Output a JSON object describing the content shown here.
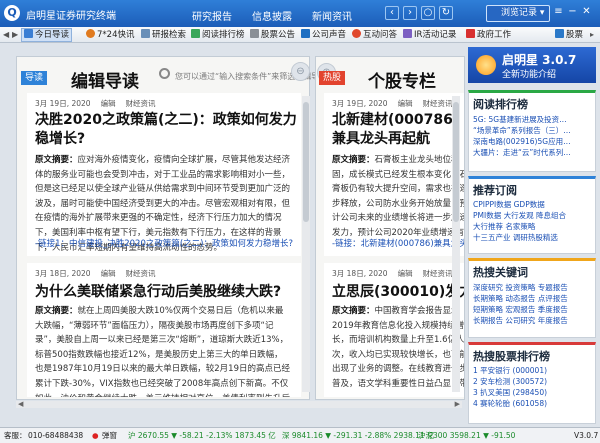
{
  "app": {
    "title": "启明星证券研究终端",
    "logo_glyph": "Q",
    "version": "V3.0.7"
  },
  "topnav": [
    {
      "label": "研究报告"
    },
    {
      "label": "信息披露"
    },
    {
      "label": "新闻资讯"
    }
  ],
  "history_button": "浏览记录",
  "toolbar": {
    "items": [
      {
        "label": "今日导读",
        "icon": "home-icon",
        "active": true
      },
      {
        "label": "7*24快讯",
        "icon": "clock-icon"
      },
      {
        "label": "研报检索",
        "icon": "document-icon"
      },
      {
        "label": "阅读排行榜",
        "icon": "chart-icon"
      },
      {
        "label": "股票公告",
        "icon": "notice-icon"
      },
      {
        "label": "公司声音",
        "icon": "speaker-icon"
      },
      {
        "label": "互动问答",
        "icon": "chat-icon"
      },
      {
        "label": "IR活动记录",
        "icon": "ir-icon"
      },
      {
        "label": "政府工作",
        "icon": "flag-icon"
      },
      {
        "label": "股票",
        "icon": "stock-icon"
      }
    ]
  },
  "left_panel": {
    "badge": "导读",
    "title": "编辑导读",
    "search_placeholder": "您可以通过“输入搜索条件”来筛选编辑导读内容",
    "articles": [
      {
        "date": "3月 19日, 2020",
        "tag1": "编辑",
        "tag2": "财经资讯",
        "title": "决胜2020之政策篇(之二)：政策如何发力稳增长?",
        "abstract_label": "原文摘要：",
        "abstract": "应对海外疫情变化，疫情向全球扩展，尽管其他发达经济体的服务业可能也会受到冲击，对于工业品的需求影响相对小一些，但是这已经足以使全球产业链从供给需求到中间环节受到更加广泛的波及，届时可能使中国经济受到更大的冲击。尽管宏观相对有限，但在疫情的海外扩展带来更强的不确定性，经济下行压力加大的情况下，美国利率中枢有望下行，美元指数有下行压力，在这样的背景下，人民币汇率短期内有望维持高流动性的态势。",
        "link": "-链接1：中信建投_决胜2020之政策篇(之二)：政策如何发力稳增长?"
      },
      {
        "date": "3月 18日, 2020",
        "tag1": "编辑",
        "tag2": "财经资讯",
        "title": "为什么美联储紧急行动后美股继续大跌?",
        "abstract_label": "原文摘要：",
        "abstract": "就在上周四美股大跌10%仅两个交易日后（危机以来最大跌幅，“薄弱环节”面临压力），隔夜美股市场再度创下多项“记录”，美股自上周一以来已经是第三次“熔断”，道琼斯大跌近13%，标普500指数跌幅也接近12%，是美股历史上第三大的单日跌幅，也是1987年10月19日以来的最大单日跌幅，较2月19日的高点已经累计下跌-30%，VIX指数也已经突破了2008年高点创下新高。不仅如此，油价和黄金继续大跌，美元维持相对高位，美债利率则先升后降。这些迹象可能都显示，市场的流动性继续在承受压力。"
      }
    ]
  },
  "right_panel": {
    "badge": "热股",
    "title": "个股专栏",
    "articles": [
      {
        "date": "3月 19日, 2020",
        "tag1": "编辑",
        "tag2": "财经资讯",
        "title": "北新建材(000786)兼具龙头再起航",
        "abstract_label": "原文摘要：",
        "abstract": "石膏板主业龙头地位稳固，成长模式已经发生根本变化，石膏板仍有较大提升空间，需求也在逐步释放，公司防水业务开始放量，预计公司未来的业绩增长将进一步加速发力，预计公司2020年业绩增速有望达到较高水平，石膏板行业集中度进一步提升，新产能稳步释放，在高端市场优势明显，规模效应逐步体现，向外延伸进一步打开增长空间，维持买入评级。",
        "link": "-链接：北新建材(000786)兼具龙头…"
      },
      {
        "date": "3月 18日, 2020",
        "tag1": "编辑",
        "tag2": "财经资讯",
        "title": "立思辰(300010)发力优",
        "abstract_label": "原文摘要：",
        "abstract": "中国教育学会报告显示2019年教育信息化投入规模持续增长，而培训机构数量上升至1.6亿人次，收入均已实现较快增长，也可能出现了业务的调整。在线教育进一步普及，语文学科重要性日益凸显，带动语文学科相关教育产业链的进一步发展。"
      }
    ]
  },
  "promo": {
    "title": "启明星 3.0.7",
    "subtitle": "全新功能介绍"
  },
  "reading_rank": {
    "title": "阅读排行榜",
    "items": [
      "5G: 5G基建新进展及投资…",
      "“场景革命”系列报告（三）…",
      "深南电路(002916)5G应用…",
      "大疆片：走进“云”时代系列…"
    ]
  },
  "recommend": {
    "title": "推荐订阅",
    "rows": [
      [
        "CPIPPI数据",
        "GDP数据"
      ],
      [
        "PMI数据",
        "大行发观",
        "降息组合"
      ],
      [
        "大行推荐",
        "名家策略"
      ],
      [
        "十三五产业",
        "调研热股精选"
      ]
    ]
  },
  "hot_keywords": {
    "title": "热搜关键词",
    "rows": [
      [
        "深度研究",
        "投资策略",
        "专题报告"
      ],
      [
        "长期策略",
        "动态报告",
        "点评报告"
      ],
      [
        "短期策略",
        "宏观报告",
        "季度报告"
      ],
      [
        "长期报告",
        "公司研究",
        "年度报告"
      ]
    ]
  },
  "hot_stocks": {
    "title": "热搜股票排行榜",
    "items": [
      "1 平安银行 (000001)",
      "2 安车检测 (300572)",
      "3 扒叉美国 (298450)",
      "4 赛轮轮胎 (601058)"
    ]
  },
  "status": {
    "service_label": "客服：",
    "phone": "010-68488438",
    "ticker_label": "弹窗",
    "quotes": [
      {
        "text": "沪 2670.55 ▼ -58.21 -2.13% 1873.45 亿",
        "dir": "down"
      },
      {
        "text": "深 9841.16 ▼ -291.31 -2.88% 2938.11 亿",
        "dir": "down"
      },
      {
        "text": "沪深300 3598.21 ▼ -91.50",
        "dir": "down"
      }
    ],
    "version": "V3.0.7"
  },
  "colors": {
    "badge_blue": "#2e82d8",
    "badge_red": "#e2432e",
    "rank_border": "#2aa845",
    "recommend_border": "#2e82d8",
    "keyword_border": "#f0a61b",
    "stock_border": "#d83a3a"
  }
}
